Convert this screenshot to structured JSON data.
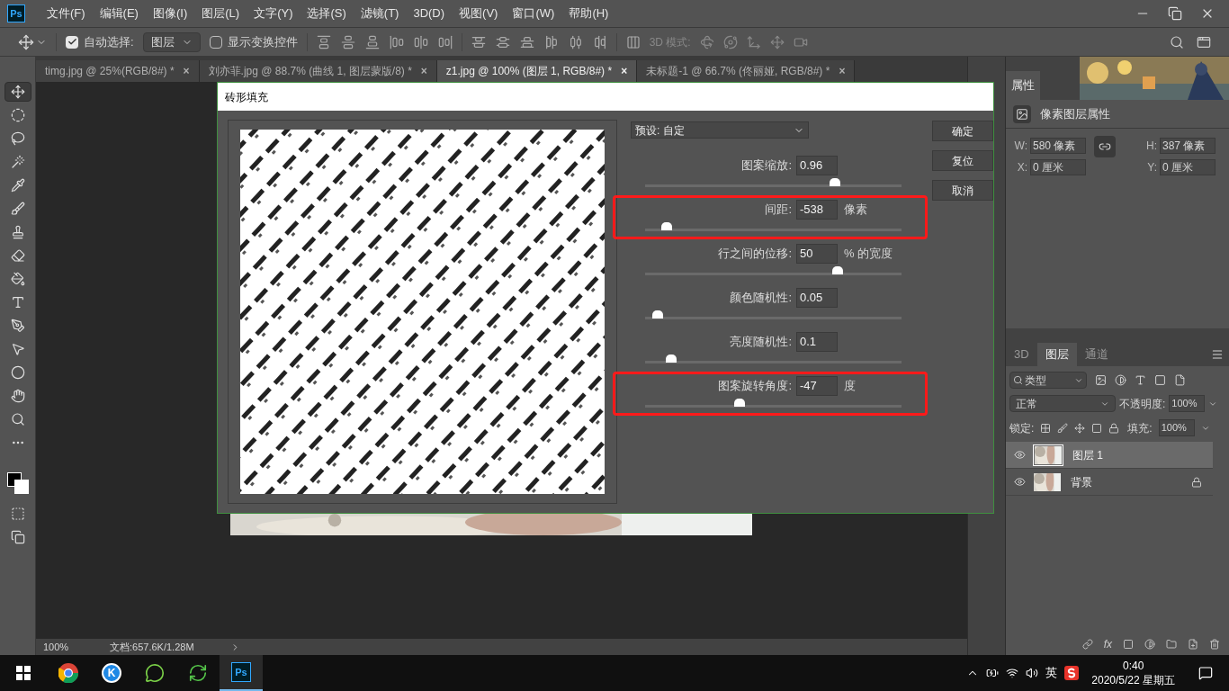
{
  "app_logo": "Ps",
  "menu": [
    "文件(F)",
    "编辑(E)",
    "图像(I)",
    "图层(L)",
    "文字(Y)",
    "选择(S)",
    "滤镜(T)",
    "3D(D)",
    "视图(V)",
    "窗口(W)",
    "帮助(H)"
  ],
  "options_bar": {
    "auto_select": {
      "label": "自动选择:",
      "checked": true
    },
    "auto_select_target": "图层",
    "show_transform": {
      "label": "显示变换控件",
      "checked": false
    },
    "mode_3d_label": "3D 模式:"
  },
  "document_tabs": [
    {
      "title": "timg.jpg @ 25%(RGB/8#) *",
      "close": "×",
      "selected": false
    },
    {
      "title": "刘亦菲.jpg @ 88.7% (曲线 1, 图层蒙版/8) *",
      "close": "×",
      "selected": false
    },
    {
      "title": "z1.jpg @ 100% (图层 1, RGB/8#) *",
      "close": "×",
      "selected": true
    },
    {
      "title": "未标题-1 @ 66.7% (佟丽娅, RGB/8#) *",
      "close": "×",
      "selected": false
    }
  ],
  "tools": [
    {
      "kind": "move",
      "selected": true
    },
    {
      "kind": "marquee",
      "selected": false
    },
    {
      "kind": "lasso",
      "selected": false
    },
    {
      "kind": "wand",
      "selected": false
    },
    {
      "kind": "eyedropper",
      "selected": false
    },
    {
      "kind": "brush",
      "selected": false
    },
    {
      "kind": "stamp",
      "selected": false
    },
    {
      "kind": "eraser",
      "selected": false
    },
    {
      "kind": "bucket",
      "selected": false
    },
    {
      "kind": "type",
      "selected": false
    },
    {
      "kind": "pen",
      "selected": false
    },
    {
      "kind": "pointer",
      "selected": false
    },
    {
      "kind": "ellipse",
      "selected": false
    },
    {
      "kind": "hand",
      "selected": false
    },
    {
      "kind": "zoom",
      "selected": false
    },
    {
      "kind": "more",
      "selected": false
    }
  ],
  "dialog": {
    "title": "砖形填充",
    "preset": "预设: 自定",
    "buttons": [
      "确定",
      "复位",
      "取消"
    ],
    "params": [
      {
        "label": "图案缩放:",
        "value": "0.96",
        "level": 0.74,
        "highlighted": false
      },
      {
        "label": "间距:",
        "value": "-538",
        "unit": "像素",
        "level": 0.085,
        "highlighted": true
      },
      {
        "label": "行之间的位移:",
        "value": "50",
        "unit": "% 的宽度",
        "level": 0.75,
        "highlighted": false
      },
      {
        "label": "颜色随机性:",
        "value": "0.05",
        "level": 0.05,
        "highlighted": false
      },
      {
        "label": "亮度随机性:",
        "value": "0.1",
        "level": 0.1,
        "highlighted": false
      },
      {
        "label": "图案旋转角度:",
        "value": "-47",
        "unit": "度",
        "level": 0.37,
        "highlighted": true
      }
    ]
  },
  "properties": {
    "tab": "属性",
    "subtitle": "像素图层属性",
    "fields": [
      {
        "label": "W:",
        "value": "580 像素"
      },
      {
        "label": "H:",
        "value": "387 像素"
      },
      {
        "label": "X:",
        "value": "0 厘米"
      },
      {
        "label": "Y:",
        "value": "0 厘米"
      }
    ]
  },
  "layers_panel": {
    "tabs": [
      {
        "label": "3D",
        "selected": false
      },
      {
        "label": "图层",
        "selected": true
      },
      {
        "label": "通道",
        "selected": false
      }
    ],
    "filter": "类型",
    "blend_mode": "正常",
    "opacity_label": "不透明度:",
    "opacity": "100%",
    "lock_label": "锁定:",
    "fill_label": "填充:",
    "fill": "100%",
    "effects_label": "fx",
    "layers": [
      {
        "name": "图层 1",
        "selected": true,
        "visible": true,
        "locked": false
      },
      {
        "name": "背景",
        "selected": false,
        "visible": true,
        "locked": true
      }
    ]
  },
  "status_bar": {
    "zoom": "100%",
    "doc_info": "文档:657.6K/1.28M"
  },
  "taskbar": {
    "apps": [
      {
        "kind": "chrome",
        "active": false
      },
      {
        "kind": "k",
        "label": "K",
        "active": false
      },
      {
        "kind": "chat",
        "active": false
      },
      {
        "kind": "green",
        "active": false
      },
      {
        "kind": "ps",
        "label": "Ps",
        "active": true
      }
    ],
    "ime": "英",
    "time": "0:40",
    "date": "2020/5/22 星期五"
  }
}
